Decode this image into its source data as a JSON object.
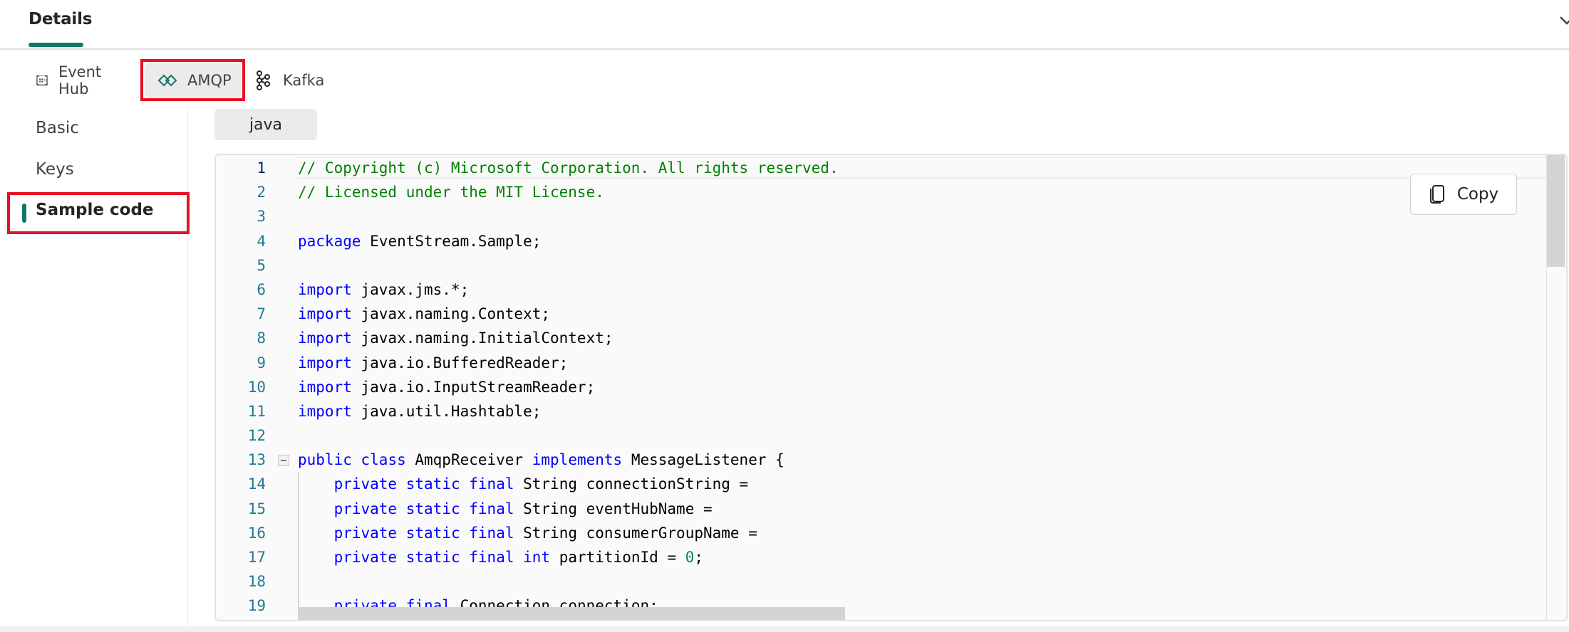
{
  "header": {
    "tab_label": "Details",
    "collapse_icon": "chevron-icon"
  },
  "toolbar": {
    "items": [
      {
        "label": "Event Hub",
        "icon": "event-hub-icon",
        "selected": false
      },
      {
        "label": "AMQP",
        "icon": "amqp-icon",
        "selected": true
      },
      {
        "label": "Kafka",
        "icon": "kafka-icon",
        "selected": false
      }
    ]
  },
  "leftnav": {
    "items": [
      {
        "label": "Basic",
        "selected": false
      },
      {
        "label": "Keys",
        "selected": false
      },
      {
        "label": "Sample code",
        "selected": true
      }
    ]
  },
  "language_tab": "java",
  "copy_button": {
    "label": "Copy",
    "icon": "copy-icon"
  },
  "colors": {
    "accent": "#117865",
    "highlight_box": "#e81123",
    "comment": "#008000",
    "keyword": "#0000ff",
    "number": "#098658",
    "line_number": "#237893"
  },
  "code": {
    "language": "java",
    "lines": [
      [
        {
          "t": "// Copyright (c) Microsoft Corporation. All rights reserved.",
          "c": "comment"
        }
      ],
      [
        {
          "t": "// Licensed under the MIT License.",
          "c": "comment"
        }
      ],
      [],
      [
        {
          "t": "package",
          "c": "kw"
        },
        {
          "t": " EventStream.Sample;"
        }
      ],
      [],
      [
        {
          "t": "import",
          "c": "kw"
        },
        {
          "t": " javax.jms.*;"
        }
      ],
      [
        {
          "t": "import",
          "c": "kw"
        },
        {
          "t": " javax.naming.Context;"
        }
      ],
      [
        {
          "t": "import",
          "c": "kw"
        },
        {
          "t": " javax.naming.InitialContext;"
        }
      ],
      [
        {
          "t": "import",
          "c": "kw"
        },
        {
          "t": " java.io.BufferedReader;"
        }
      ],
      [
        {
          "t": "import",
          "c": "kw"
        },
        {
          "t": " java.io.InputStreamReader;"
        }
      ],
      [
        {
          "t": "import",
          "c": "kw"
        },
        {
          "t": " java.util.Hashtable;"
        }
      ],
      [],
      [
        {
          "t": "public",
          "c": "kw"
        },
        {
          "t": " "
        },
        {
          "t": "class",
          "c": "kw"
        },
        {
          "t": " AmqpReceiver "
        },
        {
          "t": "implements",
          "c": "kw"
        },
        {
          "t": " MessageListener {"
        }
      ],
      [
        {
          "t": "    "
        },
        {
          "t": "private",
          "c": "kw"
        },
        {
          "t": " "
        },
        {
          "t": "static",
          "c": "kw"
        },
        {
          "t": " "
        },
        {
          "t": "final",
          "c": "kw"
        },
        {
          "t": " String connectionString ="
        }
      ],
      [
        {
          "t": "    "
        },
        {
          "t": "private",
          "c": "kw"
        },
        {
          "t": " "
        },
        {
          "t": "static",
          "c": "kw"
        },
        {
          "t": " "
        },
        {
          "t": "final",
          "c": "kw"
        },
        {
          "t": " String eventHubName ="
        }
      ],
      [
        {
          "t": "    "
        },
        {
          "t": "private",
          "c": "kw"
        },
        {
          "t": " "
        },
        {
          "t": "static",
          "c": "kw"
        },
        {
          "t": " "
        },
        {
          "t": "final",
          "c": "kw"
        },
        {
          "t": " String consumerGroupName ="
        }
      ],
      [
        {
          "t": "    "
        },
        {
          "t": "private",
          "c": "kw"
        },
        {
          "t": " "
        },
        {
          "t": "static",
          "c": "kw"
        },
        {
          "t": " "
        },
        {
          "t": "final",
          "c": "kw"
        },
        {
          "t": " "
        },
        {
          "t": "int",
          "c": "kw"
        },
        {
          "t": " partitionId = "
        },
        {
          "t": "0",
          "c": "num"
        },
        {
          "t": ";"
        }
      ],
      [],
      [
        {
          "t": "    "
        },
        {
          "t": "private",
          "c": "kw"
        },
        {
          "t": " "
        },
        {
          "t": "final",
          "c": "kw"
        },
        {
          "t": " Connection connection;"
        }
      ]
    ],
    "active_line": 1,
    "folded_marker_line": 13
  }
}
